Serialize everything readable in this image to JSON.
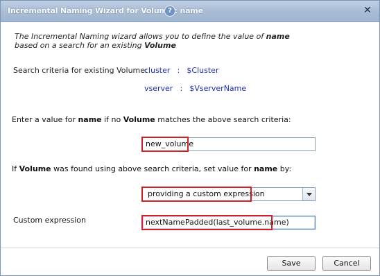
{
  "dialog": {
    "title": "Incremental Naming Wizard for Volume : name",
    "help_icon": "question-icon",
    "close_icon": "x-icon"
  },
  "intro": {
    "line1_pre": "The Incremental Naming wizard allows you to define the value of ",
    "line1_bold": "name",
    "line2_pre": "based on a search for an existing ",
    "line2_bold": "Volume"
  },
  "search_criteria": {
    "label": "Search criteria for existing Volume:",
    "items": [
      {
        "key": "cluster",
        "sep": ":",
        "value": "$Cluster"
      },
      {
        "key": "vserver",
        "sep": ":",
        "value": "$VserverName"
      }
    ]
  },
  "default_value": {
    "label_parts": [
      "Enter a value for ",
      "name",
      " if no ",
      "Volume",
      " matches the above search criteria:"
    ],
    "value": "new_volume"
  },
  "found_value": {
    "label_parts": [
      "If ",
      "Volume",
      " was found using above search criteria, set value for ",
      "name",
      " by:"
    ],
    "selected_option": "providing a custom expression"
  },
  "custom_expression": {
    "label": "Custom expression",
    "value": "nextNamePadded(last_volume.name)"
  },
  "buttons": {
    "save": "Save",
    "cancel": "Cancel"
  },
  "colors": {
    "title_bar": "#a9bdd6",
    "criteria_text": "#1a2fb0",
    "highlight_box": "#d11f2a"
  }
}
